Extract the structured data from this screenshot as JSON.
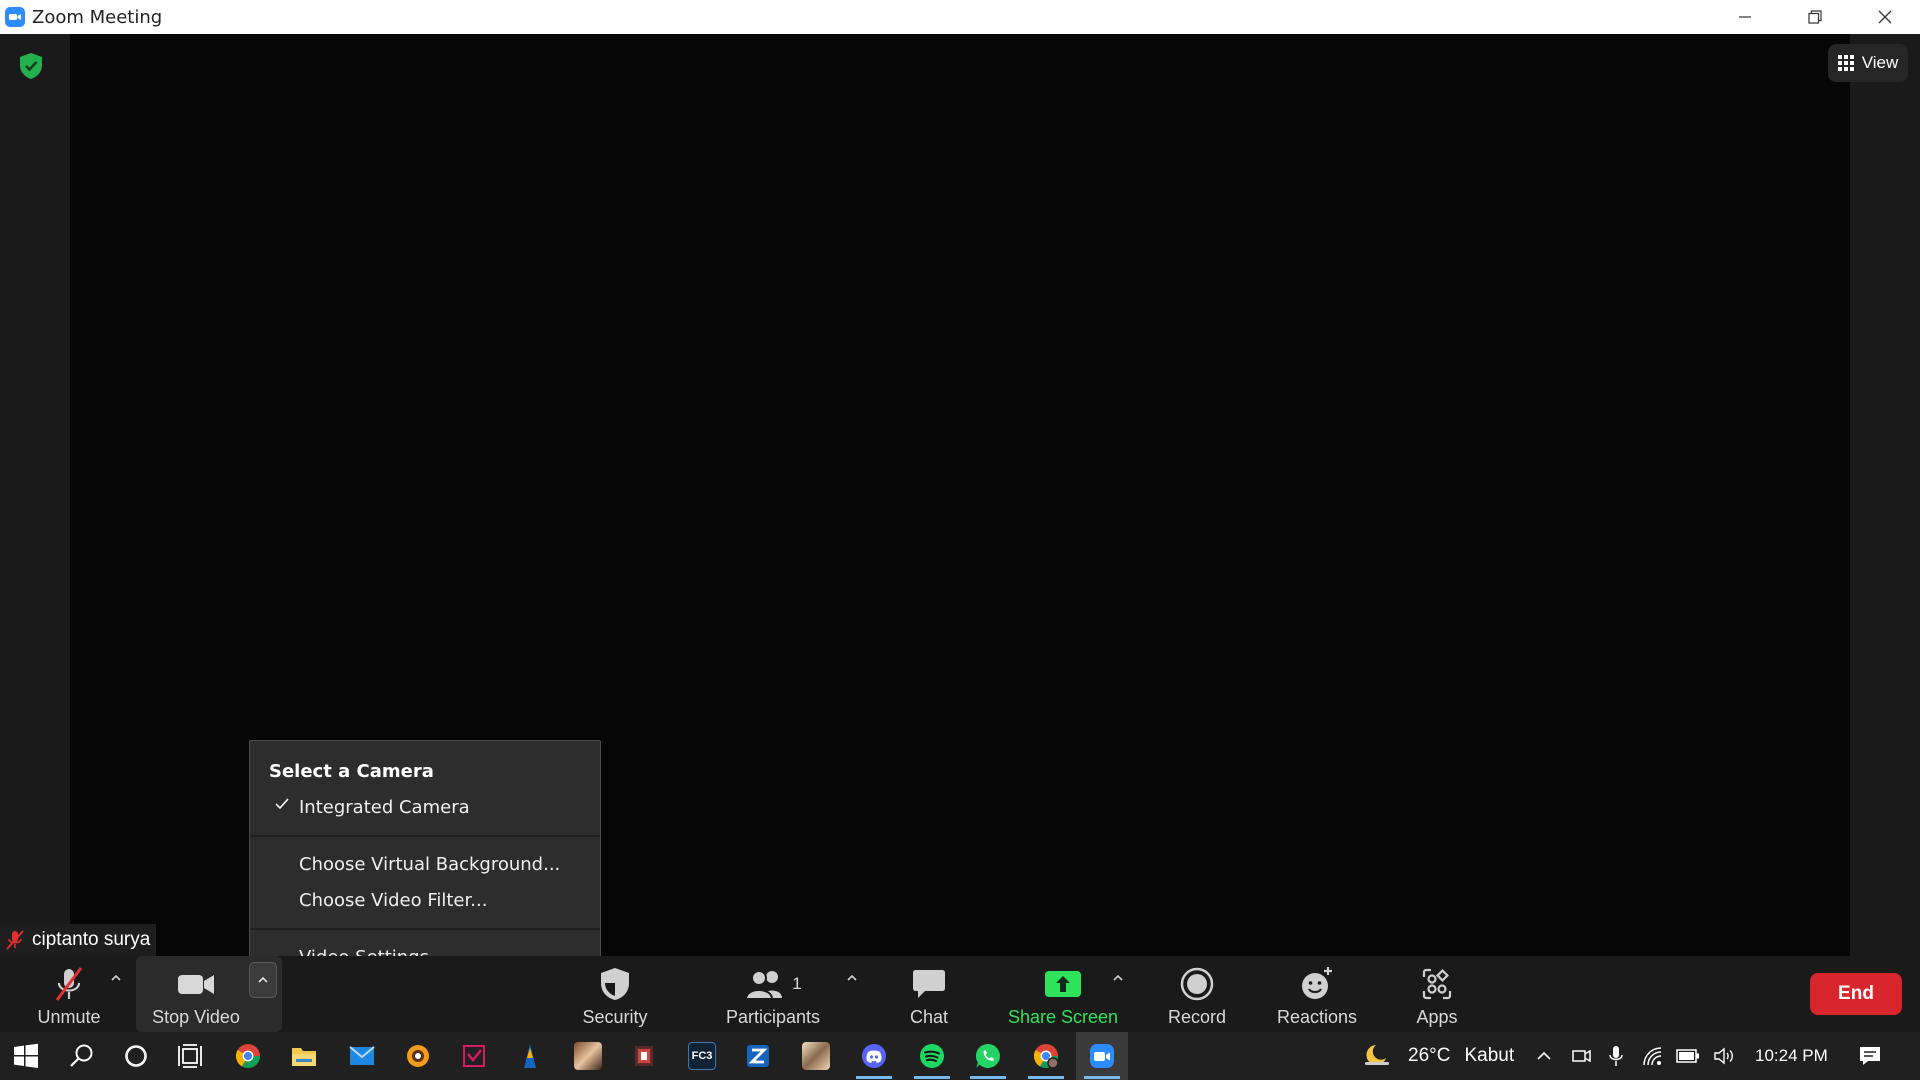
{
  "window": {
    "title": "Zoom Meeting",
    "minimize_icon": "minimize-icon",
    "restore_icon": "restore-icon",
    "close_icon": "close-icon"
  },
  "meeting": {
    "view_label": "View",
    "participant_name": "ciptanto surya",
    "encryption_icon": "shield-check-icon"
  },
  "camera_menu": {
    "heading": "Select a Camera",
    "camera_option": "Integrated Camera",
    "camera_selected": true,
    "virtual_background": "Choose Virtual Background...",
    "video_filter": "Choose Video Filter...",
    "video_settings": "Video Settings..."
  },
  "toolbar": {
    "unmute": "Unmute",
    "stop_video": "Stop Video",
    "security": "Security",
    "participants": "Participants",
    "participants_count": "1",
    "chat": "Chat",
    "share_screen": "Share Screen",
    "record": "Record",
    "reactions": "Reactions",
    "apps": "Apps",
    "end": "End"
  },
  "taskbar": {
    "weather_temp": "26°C",
    "weather_desc": "Kabut",
    "time": "10:24 PM",
    "apps": [
      "start",
      "search",
      "cortana",
      "task-view",
      "chrome",
      "file-explorer",
      "mail",
      "app-orange",
      "app-red",
      "app-blue",
      "app-photo",
      "app-game",
      "fc3",
      "app-z",
      "app-image",
      "discord",
      "spotify",
      "whatsapp",
      "chrome-2",
      "zoom"
    ]
  },
  "colors": {
    "accent_green": "#2ee25b",
    "end_red": "#d9262c",
    "zoom_blue": "#2d8cff"
  }
}
